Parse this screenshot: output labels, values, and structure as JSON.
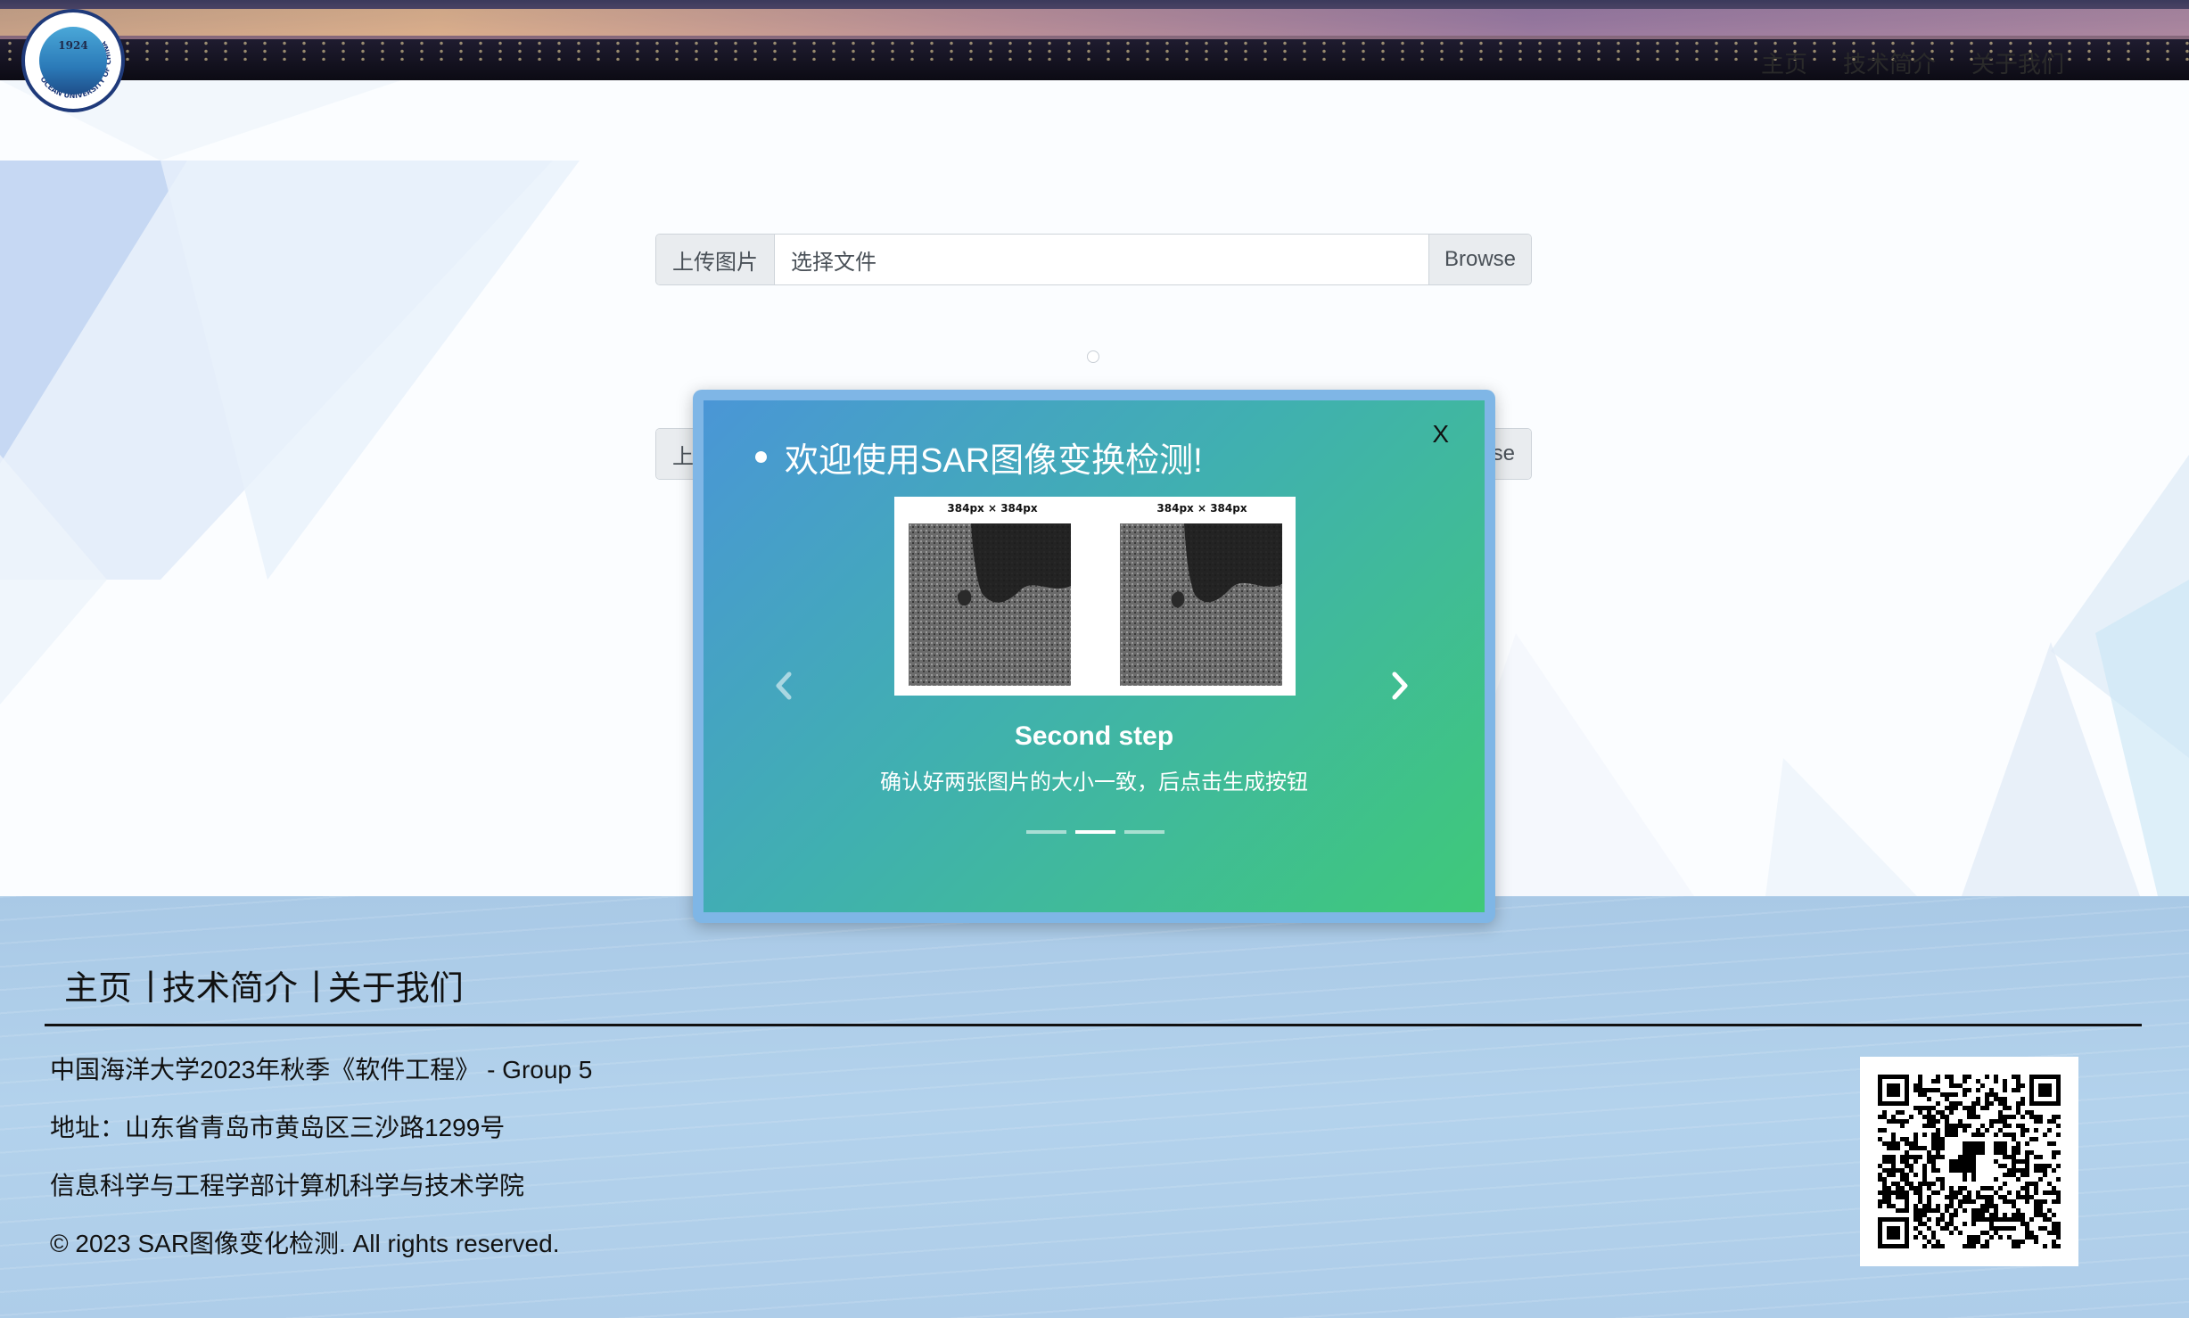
{
  "header": {
    "nav": [
      "主页",
      "技术简介",
      "关于我们"
    ]
  },
  "logo": {
    "year": "1924",
    "ring_text": "OCEAN UNIVERSITY OF CHINA"
  },
  "upload": {
    "rows": [
      {
        "label": "上传图片",
        "placeholder": "选择文件",
        "button": "Browse"
      },
      {
        "label": "上",
        "placeholder": "",
        "button": "se"
      }
    ]
  },
  "modal": {
    "close_label": "X",
    "title": "欢迎使用SAR图像变换检测!",
    "image_caption_left": "384px × 384px",
    "image_caption_right": "384px × 384px",
    "slide_heading": "Second step",
    "slide_text": "确认好两张图片的大小一致，后点击生成按钮",
    "indicators_total": 3,
    "active_index": 1
  },
  "footer": {
    "nav": [
      "主页",
      "技术简介",
      "关于我们"
    ],
    "separator": "|",
    "lines": [
      "中国海洋大学2023年秋季《软件工程》 - Group 5",
      "地址：山东省青岛市黄岛区三沙路1299号",
      "信息科学与工程学部计算机科学与技术学院",
      "© 2023 SAR图像变化检测. All rights reserved."
    ]
  },
  "icons": {
    "prev": "chevron-left-icon",
    "next": "chevron-right-icon",
    "qr": "qr-code-icon"
  }
}
